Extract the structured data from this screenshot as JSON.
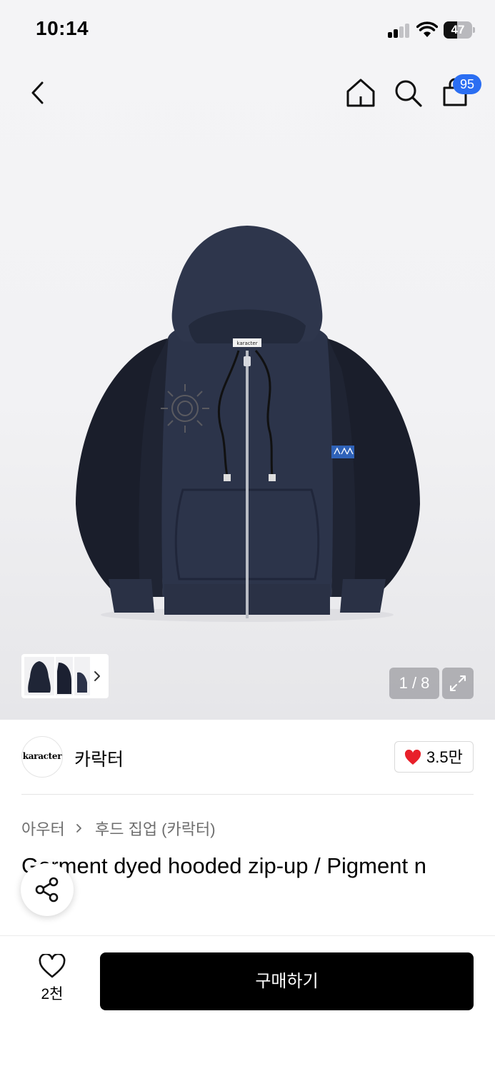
{
  "status_bar": {
    "time": "10:14",
    "battery": "47",
    "battery_level": 0.47
  },
  "header": {
    "cart_badge": "95"
  },
  "gallery": {
    "page_counter": "1 / 8"
  },
  "product_image": {
    "label_text": "karacter"
  },
  "brand": {
    "logo_text": "karacter",
    "name": "카락터",
    "like_count": "3.5만"
  },
  "breadcrumb": {
    "category": "아우터",
    "subcategory": "후드 집업 (카락터)"
  },
  "product": {
    "title": "Garment dyed hooded zip-up / Pigment n"
  },
  "bottom_bar": {
    "wish_count": "2천",
    "buy_label": "구매하기"
  },
  "colors": {
    "badge": "#2b6ef2",
    "heart": "#e8202a",
    "buy_button": "#000000",
    "hoodie_navy": "#2c344a"
  }
}
